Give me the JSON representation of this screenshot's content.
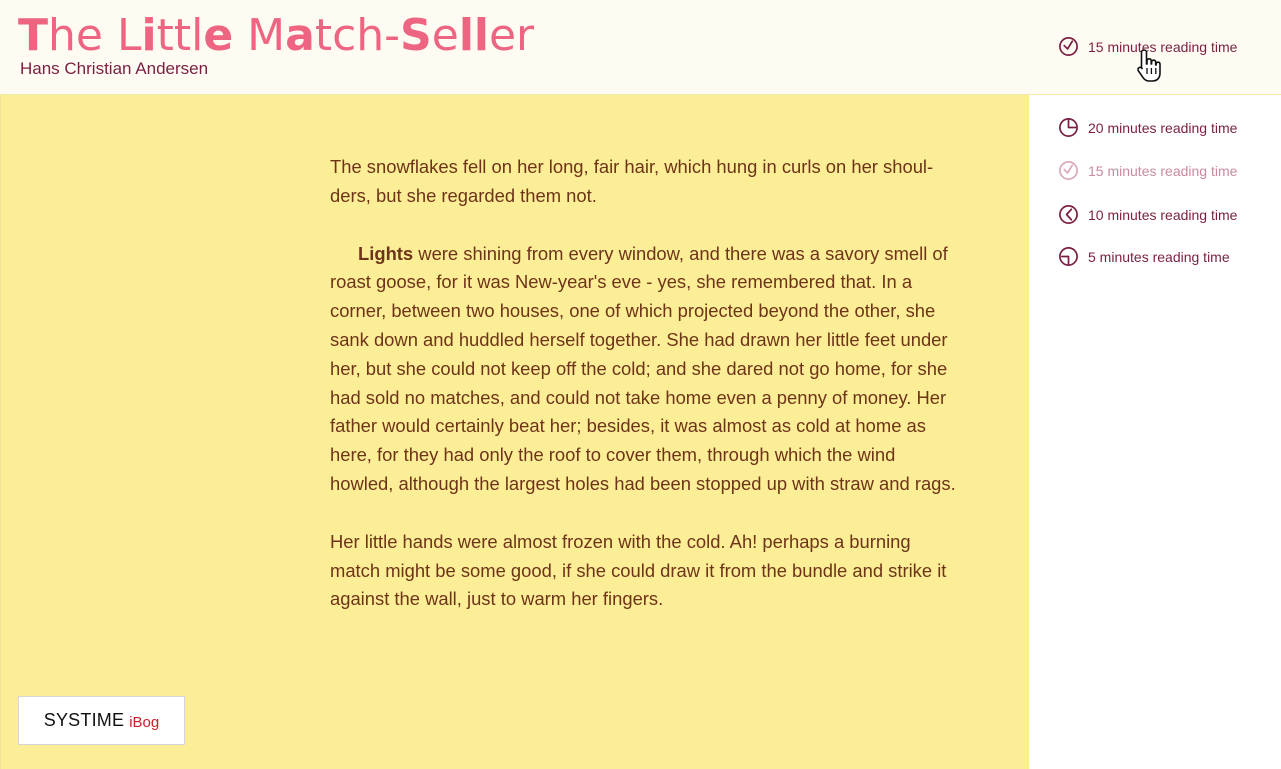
{
  "header": {
    "title_parts": [
      "T",
      "he L",
      "i",
      "ttl",
      "e",
      " M",
      "a",
      "tch-",
      "S",
      "e",
      "ll",
      "er"
    ],
    "author": "Hans Christian Andersen",
    "reading_time": "15 minutes reading time"
  },
  "story": {
    "p1": "The snowflakes fell on her long, fair hair, which hung in curls on her shoul-ders, but she regarded them not.",
    "p2_lead": "Lights",
    "p2_rest": " were shining from every window, and there was a savory smell of roast goose, for it was New-year's eve - yes, she remembered that. In a corner, between two houses, one of which projected beyond the other, she sank down and huddled herself together. She had drawn her little feet under her, but she could not keep off the cold; and she dared not go home, for she had sold no matches, and could not take home even a penny of money. Her father would certainly beat her; besides, it was almost as cold at home as here, for they had only the roof to cover them, through which the wind howled, although the largest holes had been stopped up with straw and rags.",
    "p3": "Her little hands were almost frozen with the cold. Ah! perhaps a burning match might be some good, if she could draw it from the bundle and strike it against the wall, just to warm her fingers."
  },
  "logo": {
    "main": "SYSTIME",
    "sub": "iBog"
  },
  "sidebar": {
    "items": [
      {
        "label": "20 minutes reading time",
        "icon": "clock-20-icon"
      },
      {
        "label": "15 minutes reading time",
        "icon": "clock-15-icon"
      },
      {
        "label": "10 minutes reading time",
        "icon": "clock-10-icon"
      },
      {
        "label": "5 minutes reading time",
        "icon": "clock-5-icon"
      }
    ]
  },
  "colors": {
    "title_pink": "#ee6581",
    "author_maroon": "#7a1f43",
    "content_bg": "#fcee96",
    "story_text": "#6e3419",
    "logo_red": "#c81f2d"
  }
}
